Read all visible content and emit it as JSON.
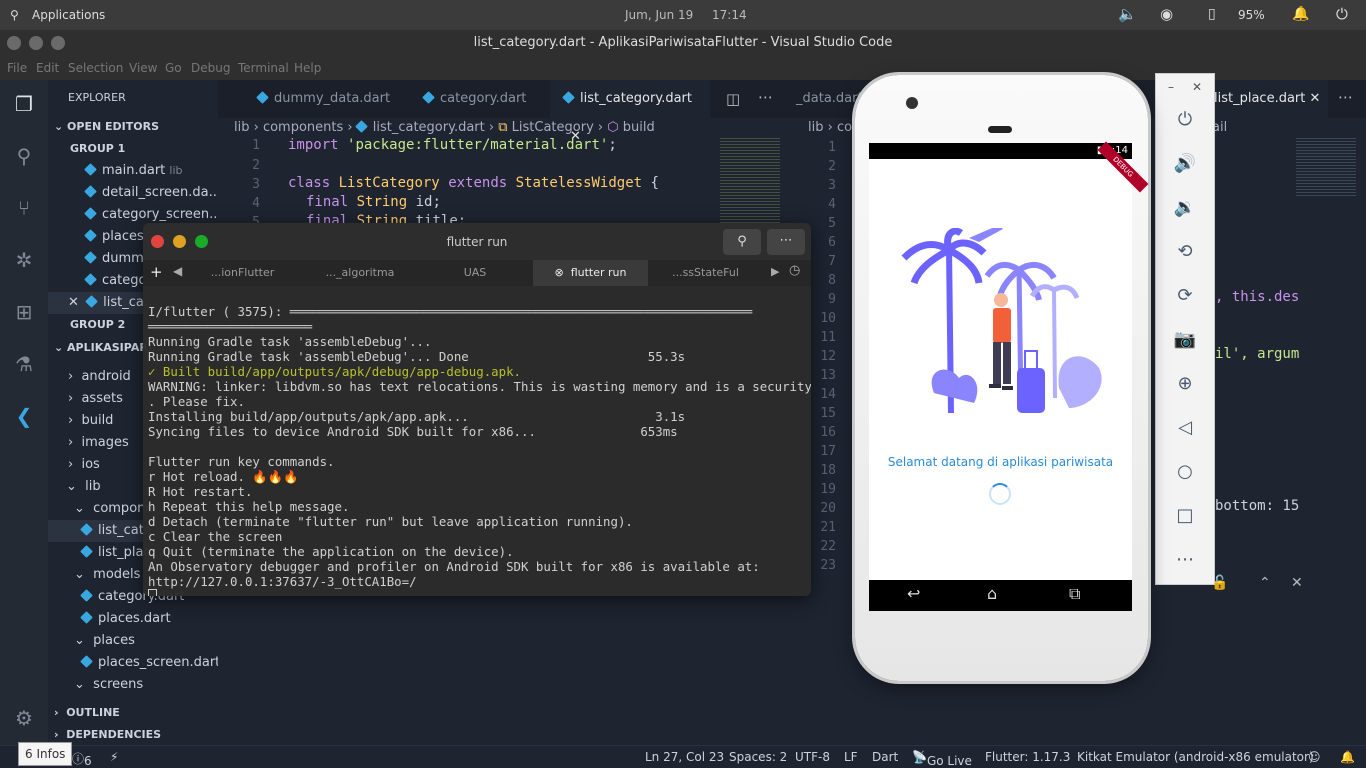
{
  "system": {
    "app_menu": "Applications",
    "date": "Jum, Jun 19",
    "time": "17:14",
    "battery": "95%"
  },
  "window": {
    "title": "list_category.dart - AplikasiPariwisataFlutter - Visual Studio Code"
  },
  "menu": [
    "File",
    "Edit",
    "Selection",
    "View",
    "Go",
    "Debug",
    "Terminal",
    "Help"
  ],
  "explorer": {
    "title": "EXPLORER",
    "open_editors": "OPEN EDITORS",
    "group1": "GROUP 1",
    "group2": "GROUP 2",
    "files_group1": [
      "main.dart",
      "detail_screen.da...",
      "category_screen...",
      "places...",
      "dummy...",
      "catego...",
      "list_ca..."
    ],
    "main_dart_suffix": "lib",
    "project": "APLIKASIPARI...",
    "tree": [
      "android",
      "assets",
      "build",
      "images",
      "ios",
      "lib",
      "compone...",
      "list_cate...",
      "list_plac...",
      "models",
      "category.dart",
      "places.dart",
      "places",
      "places_screen.dart",
      "screens"
    ],
    "outline": "OUTLINE",
    "dependencies": "DEPENDENCIES"
  },
  "editor1": {
    "tabs": [
      "dummy_data.dart",
      "category.dart",
      "list_category.dart"
    ],
    "breadcrumb": [
      "lib",
      "components",
      "list_category.dart",
      "ListCategory",
      "build"
    ],
    "lines": [
      "1",
      "2",
      "3",
      "4",
      "5"
    ],
    "code": {
      "l1_kw": "import",
      "l1_str": "'package:flutter/material.dart'",
      "l1_end": ";",
      "l3_kw": "class",
      "l3_name": "ListCategory",
      "l3_kw2": "extends",
      "l3_type": "StatelessWidget",
      "l3_end": "{",
      "l4_kw": "final",
      "l4_type": "String",
      "l4_end": "id;",
      "l5_kw": "final",
      "l5_type": "String",
      "l5_end": "title;"
    }
  },
  "editor2": {
    "tabs": [
      "_data.dart",
      "list_place.dart"
    ],
    "breadcrumb": [
      "lib",
      "co...",
      "ail"
    ],
    "lines": [
      "1",
      "2",
      "3",
      "4",
      "5",
      "6",
      "7",
      "8",
      "9",
      "10",
      "11",
      "12",
      "13",
      "14",
      "15",
      "16",
      "17",
      "18",
      "19",
      "20",
      "21",
      "22",
      "23"
    ],
    "frag1": ", this.des",
    "frag2": "il', argum",
    "frag3": "bottom: 15"
  },
  "terminal": {
    "title": "flutter run",
    "tabs": [
      "...ionFlutter",
      "..._algoritma",
      "UAS",
      "flutter run",
      "...ssStateFul"
    ],
    "lines": [
      "I/flutter ( 3575): ══════════════════════════════════════════════════════════════",
      "══════════════════════",
      "Running Gradle task 'assembleDebug'...",
      "Running Gradle task 'assembleDebug'... Done                        55.3s",
      "✓ Built build/app/outputs/apk/debug/app-debug.apk.",
      "WARNING: linker: libdvm.so has text relocations. This is wasting memory and is a security risk",
      ". Please fix.",
      "Installing build/app/outputs/apk/app.apk...                         3.1s",
      "Syncing files to device Android SDK built for x86...              653ms",
      "",
      "Flutter run key commands.",
      "r Hot reload. 🔥🔥🔥",
      "R Hot restart.",
      "h Repeat this help message.",
      "d Detach (terminate \"flutter run\" but leave application running).",
      "c Clear the screen",
      "q Quit (terminate the application on the device).",
      "An Observatory debugger and profiler on Android SDK built for x86 is available at:",
      "http://127.0.0.1:37637/-3_OttCA1Bo=/"
    ]
  },
  "phone": {
    "clock": "5:14",
    "welcome": "Selamat datang di aplikasi pariwisata",
    "debug_banner": "DEBUG"
  },
  "statusbar": {
    "infos": "6 Infos",
    "problems": "6",
    "position": "Ln 27, Col 23",
    "spaces": "Spaces: 2",
    "encoding": "UTF-8",
    "eol": "LF",
    "language": "Dart",
    "golive": "Go Live",
    "flutter": "Flutter: 1.17.3",
    "device": "Kitkat Emulator (android-x86 emulator)"
  },
  "colors": {
    "accent": "#39a8e0",
    "illustration": "#6c63ff",
    "person_shirt": "#f2603a"
  }
}
